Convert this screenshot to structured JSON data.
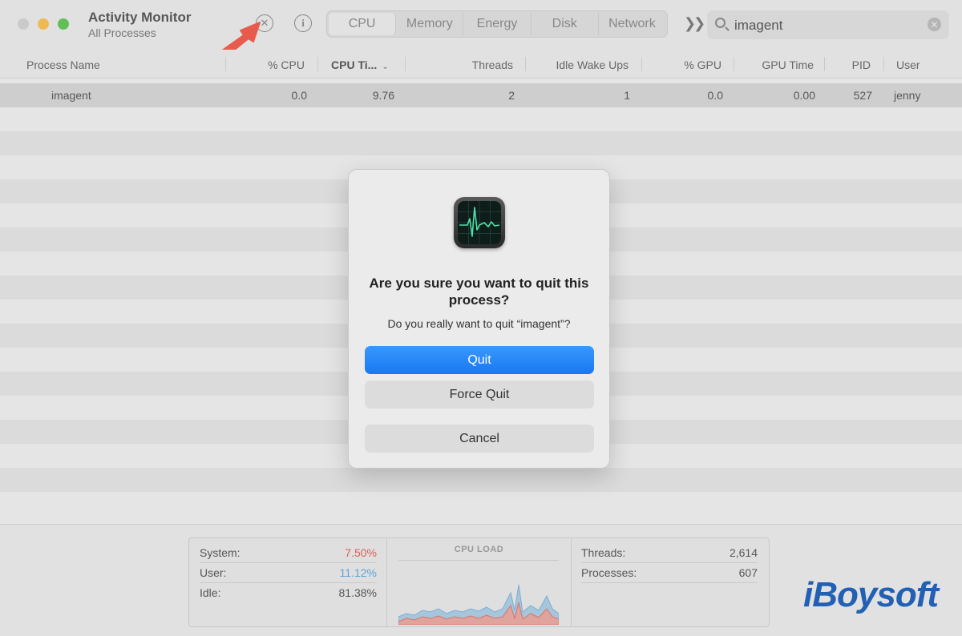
{
  "window": {
    "title": "Activity Monitor",
    "subtitle": "All Processes"
  },
  "toolbar": {
    "tabs": [
      {
        "label": "CPU",
        "active": true
      },
      {
        "label": "Memory",
        "active": false
      },
      {
        "label": "Energy",
        "active": false
      },
      {
        "label": "Disk",
        "active": false
      },
      {
        "label": "Network",
        "active": false
      }
    ],
    "search_value": "imagent"
  },
  "table": {
    "columns": [
      "Process Name",
      "% CPU",
      "CPU Ti...",
      "Threads",
      "Idle Wake Ups",
      "% GPU",
      "GPU Time",
      "PID",
      "User"
    ],
    "sorted_column": "CPU Ti...",
    "rows": [
      {
        "process_name": "imagent",
        "cpu": "0.0",
        "cpu_time": "9.76",
        "threads": "2",
        "idle_wake_ups": "1",
        "gpu": "0.0",
        "gpu_time": "0.00",
        "pid": "527",
        "user": "jenny"
      }
    ]
  },
  "stats": {
    "system": {
      "label": "System:",
      "value": "7.50%",
      "color": "#e0605a"
    },
    "user": {
      "label": "User:",
      "value": "11.12%",
      "color": "#5aa8e0"
    },
    "idle": {
      "label": "Idle:",
      "value": "81.38%"
    },
    "cpu_load_title": "CPU LOAD",
    "threads": {
      "label": "Threads:",
      "value": "2,614"
    },
    "processes": {
      "label": "Processes:",
      "value": "607"
    }
  },
  "dialog": {
    "title": "Are you sure you want to quit this process?",
    "message": "Do you really want to quit “imagent”?",
    "quit_label": "Quit",
    "force_quit_label": "Force Quit",
    "cancel_label": "Cancel",
    "accent": "#1779f3"
  },
  "watermark": "iBoysoft",
  "icons": {
    "stop": "stop-process-icon",
    "info": "info-icon",
    "more": "double-chevron-icon",
    "search": "search-icon",
    "clear": "clear-search-icon",
    "app": "activity-monitor-icon",
    "annotation": "red-arrow-annotation"
  }
}
